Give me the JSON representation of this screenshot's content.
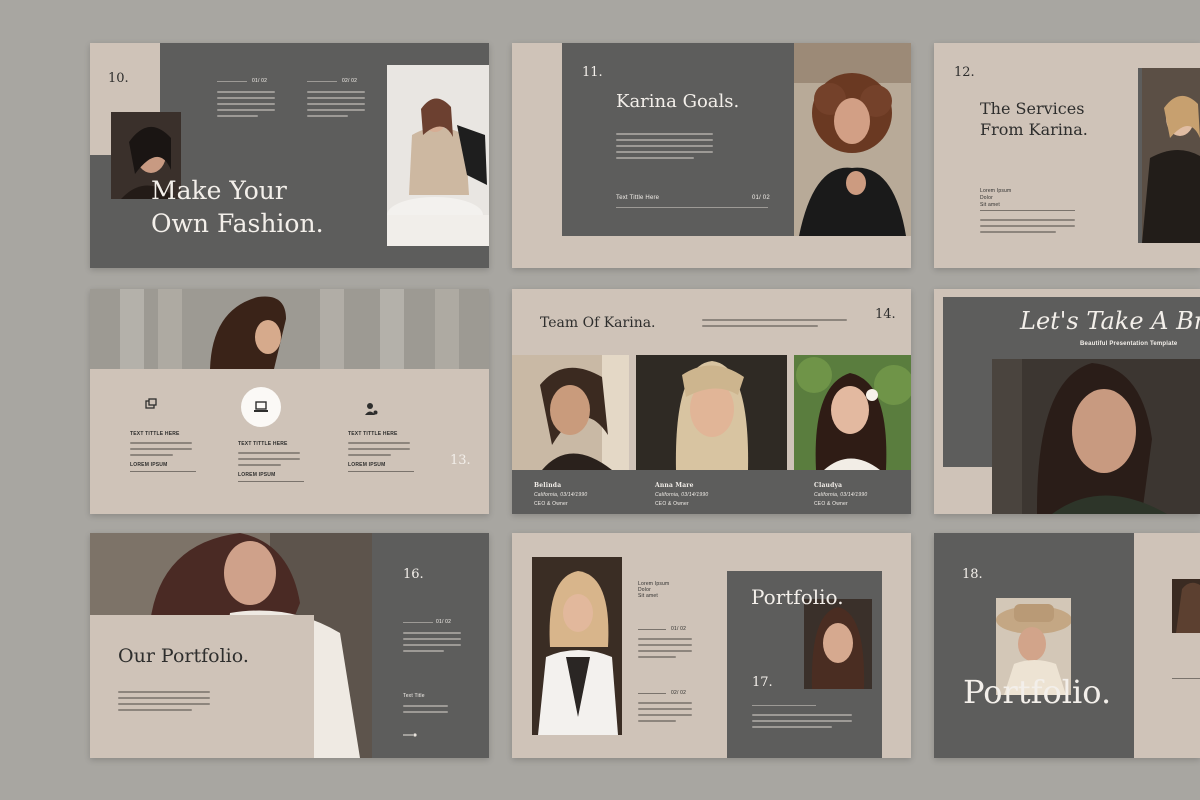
{
  "slides": {
    "s10": {
      "number": "10.",
      "title_line1": "Make Your",
      "title_line2": "Own Fashion.",
      "tab_left": "01/ 02",
      "tab_right": "02/ 02"
    },
    "s11": {
      "number": "11.",
      "title": "Karina Goals.",
      "footer_label": "Text Tittle Here",
      "footer_page": "01/ 02"
    },
    "s12": {
      "number": "12.",
      "title_line1": "The Services",
      "title_line2": "From Karina.",
      "small_line1": "Lorem Ipsum",
      "small_line2": "Dolor",
      "small_line3": "Sit amet"
    },
    "s13": {
      "number": "13.",
      "features": [
        {
          "icon": "share-icon",
          "title": "TEXT TITTLE HERE",
          "link": "LOREM IPSUM"
        },
        {
          "icon": "laptop-icon",
          "title": "TEXT TITTLE HERE",
          "link": "LOREM IPSUM"
        },
        {
          "icon": "user-settings-icon",
          "title": "TEXT TITTLE HERE",
          "link": "LOREM IPSUM"
        }
      ]
    },
    "s14": {
      "number": "14.",
      "title": "Team Of Karina.",
      "members": [
        {
          "name": "Belinda",
          "place": "California, 03/14/1990",
          "role": "CEO & Owner"
        },
        {
          "name": "Anna Mare",
          "place": "California, 03/14/1990",
          "role": "CEO & Owner"
        },
        {
          "name": "Claudya",
          "place": "California, 03/14/1990",
          "role": "CEO & Owner"
        }
      ]
    },
    "s15": {
      "title": "Let's Take A Br",
      "subtitle": "Beautiful Presentation Template"
    },
    "s16": {
      "number": "16.",
      "title": "Our Portfolio.",
      "page": "01/ 02",
      "text_title": "Text Title"
    },
    "s17": {
      "number": "17.",
      "title": "Portfolio.",
      "small_line1": "Lorem Ipsum",
      "small_line2": "Dolor",
      "small_line3": "Sit amet",
      "page1": "01/ 02",
      "page2": "02/ 02"
    },
    "s18": {
      "number": "18.",
      "title": "Portfolio."
    }
  },
  "colors": {
    "background": "#a8a6a1",
    "beige": "#cfc3b8",
    "gray": "#5d5d5c",
    "cream": "#f3efea"
  }
}
